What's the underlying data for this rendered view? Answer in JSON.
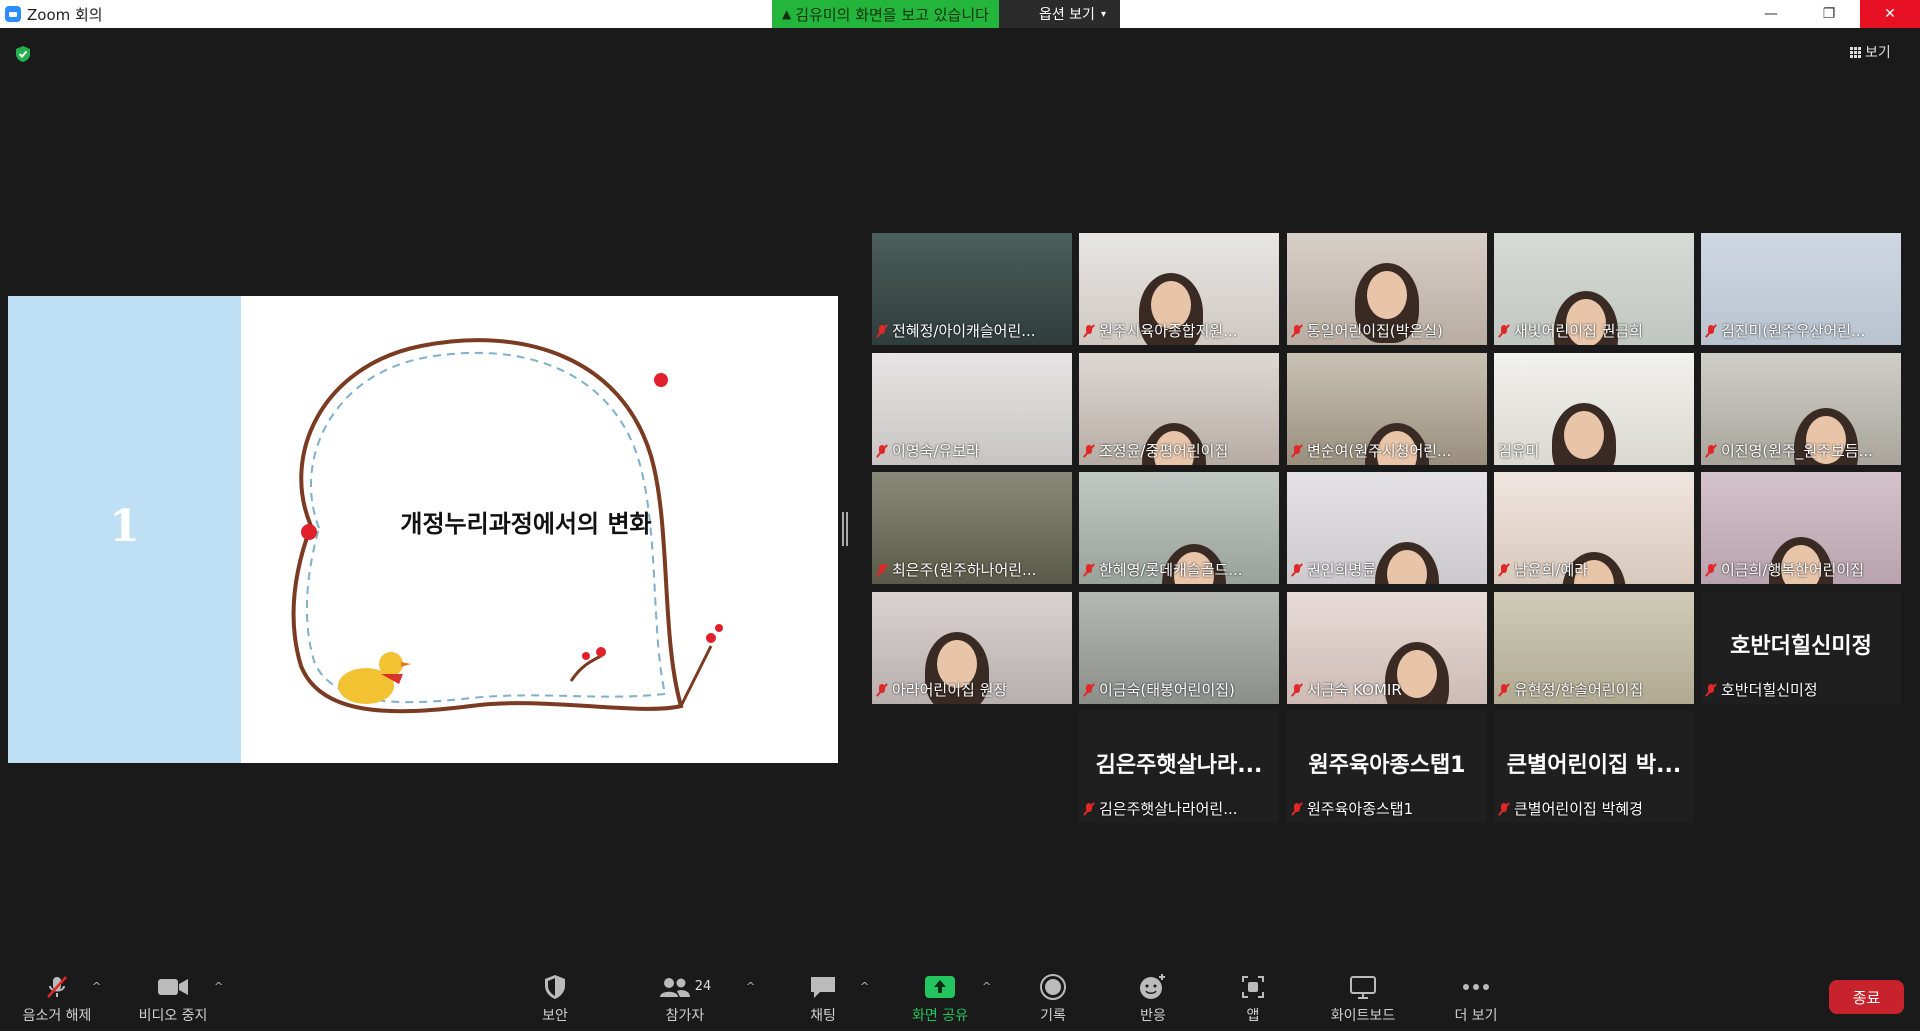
{
  "window": {
    "title": "Zoom 회의"
  },
  "share_banner": {
    "viewing_text": "김유미의 화면을 보고 있습니다",
    "options_label": "옵션 보기"
  },
  "view_button": {
    "label": "보기"
  },
  "slide": {
    "number": "1",
    "title": "개정누리과정에서의 변화"
  },
  "participants": [
    {
      "name": "전혜정/아이캐슬어린...",
      "muted": true
    },
    {
      "name": "원주시육아종합지원...",
      "muted": true
    },
    {
      "name": "통일어린이집(박은실)",
      "muted": true
    },
    {
      "name": "새빛어린이집 권금희",
      "muted": true
    },
    {
      "name": "김진미(원주우산어린...",
      "muted": true
    },
    {
      "name": "이영숙/유보라",
      "muted": true
    },
    {
      "name": "조정윤/중평어린이집",
      "muted": true
    },
    {
      "name": "변순여(원주시청어린...",
      "muted": true
    },
    {
      "name": "김유미",
      "muted": false,
      "active": true
    },
    {
      "name": "이진영(원주_원주보듬...",
      "muted": true
    },
    {
      "name": "최은주(원주하나어린...",
      "muted": true
    },
    {
      "name": "한혜영/롯데캐슬골드...",
      "muted": true
    },
    {
      "name": "권인희명륜",
      "muted": true
    },
    {
      "name": "남윤희/예라",
      "muted": true
    },
    {
      "name": "이금희/행복한어린이집",
      "muted": true
    },
    {
      "name": "아라어린이집 원장",
      "muted": true
    },
    {
      "name": "이금숙(태봉어린이집)",
      "muted": true
    },
    {
      "name": "서금숙 KOMIR",
      "muted": true
    },
    {
      "name": "유현정/한솔어린이집",
      "muted": true
    },
    {
      "name": "호반더힐신미정",
      "muted": true,
      "big_name": "호반더힐신미정"
    },
    {
      "name": "김은주햇살나라어린...",
      "muted": true,
      "big_name": "김은주햇살나라..."
    },
    {
      "name": "원주육아종스탭1",
      "muted": true,
      "big_name": "원주육아종스탭1"
    },
    {
      "name": "큰별어린이집 박혜경",
      "muted": true,
      "big_name": "큰별어린이집 박..."
    }
  ],
  "toolbar": {
    "unmute": "음소거 해제",
    "stop_video": "비디오 중지",
    "security": "보안",
    "participants": "참가자",
    "participants_count": "24",
    "chat": "채팅",
    "share_screen": "화면 공유",
    "record": "기록",
    "reactions": "반응",
    "apps": "앱",
    "whiteboard": "화이트보드",
    "more": "더 보기",
    "end": "종료"
  }
}
